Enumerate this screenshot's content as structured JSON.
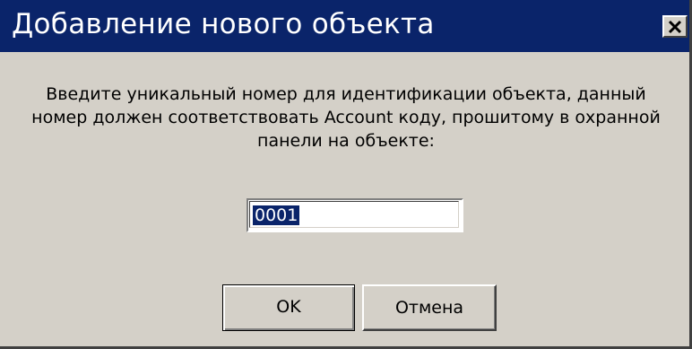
{
  "window": {
    "title": "Добавление нового объекта",
    "close_icon": "close-icon"
  },
  "message": {
    "line1": "Введите уникальный номер для идентификации объекта, данный",
    "line2": "номер должен соответствовать Account коду, прошитому в охранной",
    "line3": "панели на объекте:"
  },
  "input": {
    "value": "0001",
    "selected": true
  },
  "buttons": {
    "ok_label": "OK",
    "cancel_label": "Отмена"
  },
  "colors": {
    "titlebar": "#0a246a",
    "face": "#d4d0c8",
    "selection": "#0a246a"
  }
}
